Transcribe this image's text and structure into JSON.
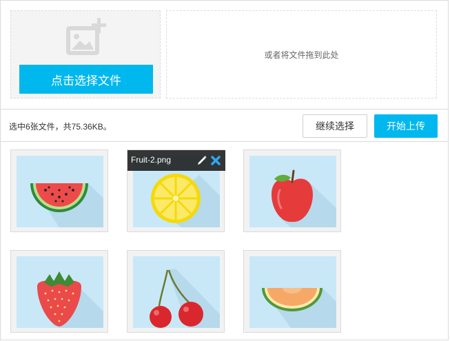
{
  "picker": {
    "button_label": "点击选择文件",
    "icon": "image-add-icon"
  },
  "dropzone": {
    "hint": "或者将文件拖到此处"
  },
  "status": {
    "info": "选中6张文件，共75.36KB。",
    "continue_label": "继续选择",
    "start_label": "开始上传"
  },
  "files": [
    {
      "icon": "watermelon-icon"
    },
    {
      "icon": "lemon-icon",
      "name": "Fruit-2.png",
      "overlay": true,
      "actions": [
        "pencil-icon",
        "close-icon"
      ]
    },
    {
      "icon": "apple-icon"
    },
    {
      "icon": "strawberry-icon"
    },
    {
      "icon": "cherry-icon"
    },
    {
      "icon": "cantaloupe-icon"
    }
  ],
  "colors": {
    "accent": "#00b7ee",
    "thumb_bg": "#c8e8f8",
    "overlay_bg": "#141414",
    "remove_icon": "#2fa8ee"
  }
}
